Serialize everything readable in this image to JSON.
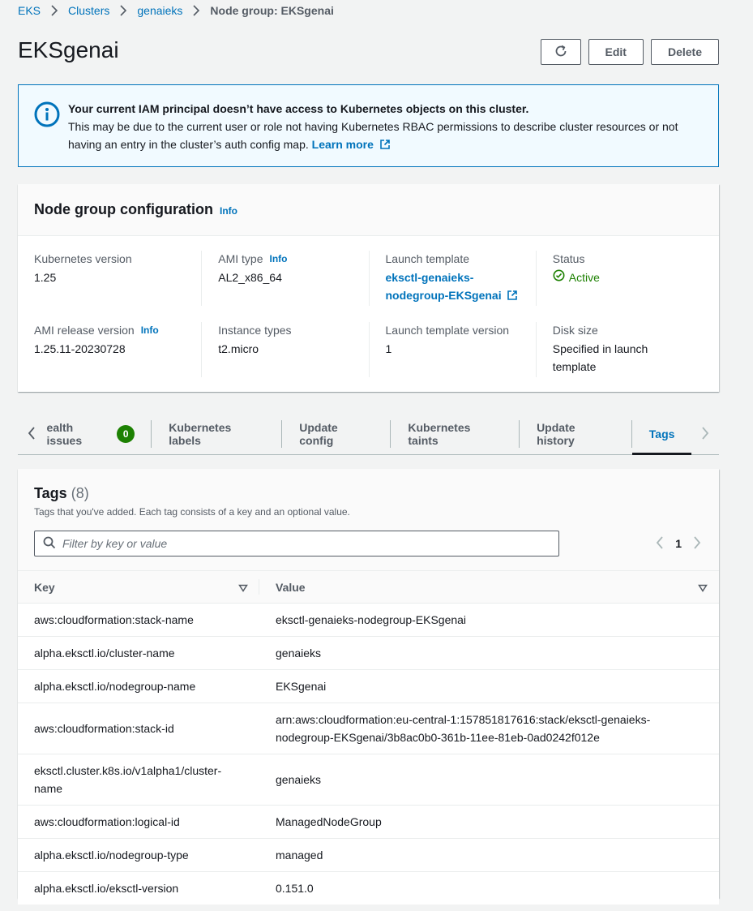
{
  "breadcrumb": {
    "items": [
      "EKS",
      "Clusters",
      "genaieks"
    ],
    "current": "Node group: EKSgenai"
  },
  "page": {
    "title": "EKSgenai",
    "edit_label": "Edit",
    "delete_label": "Delete"
  },
  "alert": {
    "title": "Your current IAM principal doesn’t have access to Kubernetes objects on this cluster.",
    "body": "This may be due to the current user or role not having Kubernetes RBAC permissions to describe cluster resources or not having an entry in the cluster’s auth config map.",
    "link": "Learn more"
  },
  "config": {
    "title": "Node group configuration",
    "info": "Info",
    "kubernetes_version": {
      "label": "Kubernetes version",
      "value": "1.25"
    },
    "ami_type": {
      "label": "AMI type",
      "info": "Info",
      "value": "AL2_x86_64"
    },
    "launch_template": {
      "label": "Launch template",
      "value_line1": "eksctl-genaieks-",
      "value_line2": "nodegroup-EKSgenai"
    },
    "status": {
      "label": "Status",
      "value": "Active"
    },
    "ami_release": {
      "label": "AMI release version",
      "info": "Info",
      "value": "1.25.11-20230728"
    },
    "instance_types": {
      "label": "Instance types",
      "value": "t2.micro"
    },
    "launch_template_version": {
      "label": "Launch template version",
      "value": "1"
    },
    "disk_size": {
      "label": "Disk size",
      "value_line1": "Specified in launch",
      "value_line2": "template"
    }
  },
  "tabs": {
    "health": {
      "label": "ealth issues",
      "count": "0"
    },
    "labels": "Kubernetes labels",
    "update_config": "Update config",
    "taints": "Kubernetes taints",
    "history": "Update history",
    "tags": "Tags"
  },
  "tags": {
    "title": "Tags",
    "count": "(8)",
    "description": "Tags that you've added. Each tag consists of a key and an optional value.",
    "filter_placeholder": "Filter by key or value",
    "page": "1",
    "columns": {
      "key": "Key",
      "value": "Value"
    },
    "rows": [
      {
        "key": "aws:cloudformation:stack-name",
        "value": "eksctl-genaieks-nodegroup-EKSgenai"
      },
      {
        "key": "alpha.eksctl.io/cluster-name",
        "value": "genaieks"
      },
      {
        "key": "alpha.eksctl.io/nodegroup-name",
        "value": "EKSgenai"
      },
      {
        "key": "aws:cloudformation:stack-id",
        "value_line1": "arn:aws:cloudformation:eu-central-1:157851817616:stack/eksctl-genaieks-",
        "value_line2": "nodegroup-EKSgenai/3b8ac0b0-361b-11ee-81eb-0ad0242f012e"
      },
      {
        "key_line1": "eksctl.cluster.k8s.io/v1alpha1/cluster-",
        "key_line2": "name",
        "value": "genaieks"
      },
      {
        "key": "aws:cloudformation:logical-id",
        "value": "ManagedNodeGroup"
      },
      {
        "key": "alpha.eksctl.io/nodegroup-type",
        "value": "managed"
      },
      {
        "key": "alpha.eksctl.io/eksctl-version",
        "value": "0.151.0"
      }
    ]
  },
  "colors": {
    "link": "#0073bb",
    "success": "#1d8102",
    "alert_bg": "#f1faff",
    "text": "#16191f"
  }
}
